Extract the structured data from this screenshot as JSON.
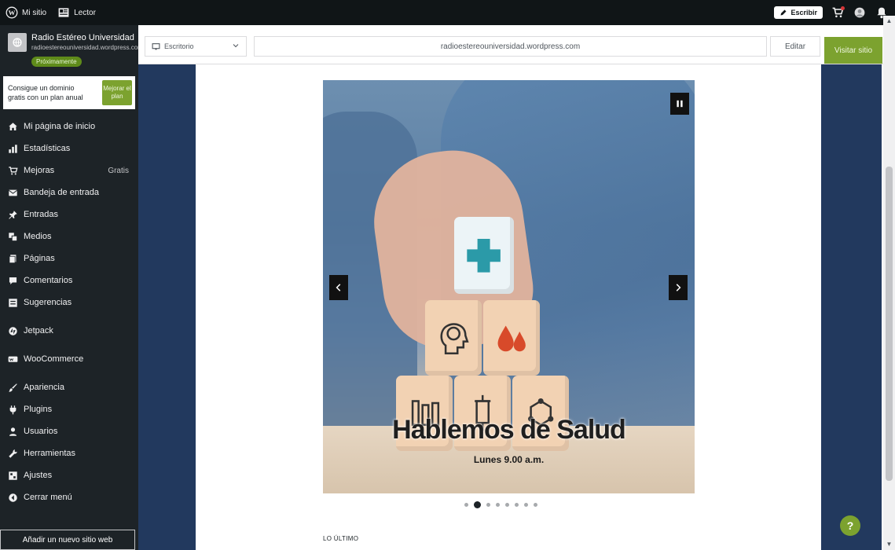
{
  "adminbar": {
    "my_site": "Mi sitio",
    "reader": "Lector",
    "write": "Escribir",
    "icons": [
      "wordpress-icon",
      "reader-icon",
      "pencil-icon",
      "cart-icon",
      "avatar",
      "bell-icon"
    ]
  },
  "sidebar": {
    "site_name": "Radio Estéreo Universidad",
    "site_url": "radioestereouniversidad.wordpress.com",
    "badge": "Próximamente",
    "promo_text": "Consigue un dominio gratis con un plan anual",
    "promo_button": "Mejorar el plan",
    "items": [
      {
        "label": "Mi página de inicio",
        "icon": "home-icon"
      },
      {
        "label": "Estadísticas",
        "icon": "stats-icon"
      },
      {
        "label": "Mejoras",
        "icon": "cart-icon",
        "extra": "Gratis"
      },
      {
        "label": "Bandeja de entrada",
        "icon": "inbox-icon"
      },
      {
        "label": "Entradas",
        "icon": "pin-icon"
      },
      {
        "label": "Medios",
        "icon": "media-icon"
      },
      {
        "label": "Páginas",
        "icon": "pages-icon"
      },
      {
        "label": "Comentarios",
        "icon": "comment-icon"
      },
      {
        "label": "Sugerencias",
        "icon": "feedback-icon"
      },
      {
        "label": "Jetpack",
        "icon": "jetpack-icon"
      },
      {
        "label": "WooCommerce",
        "icon": "woocommerce-icon"
      },
      {
        "label": "Apariencia",
        "icon": "brush-icon"
      },
      {
        "label": "Plugins",
        "icon": "plug-icon"
      },
      {
        "label": "Usuarios",
        "icon": "users-icon"
      },
      {
        "label": "Herramientas",
        "icon": "wrench-icon"
      },
      {
        "label": "Ajustes",
        "icon": "settings-icon"
      },
      {
        "label": "Cerrar menú",
        "icon": "collapse-icon"
      }
    ],
    "add_site": "Añadir un nuevo sitio web"
  },
  "toolbar": {
    "device": "Escritorio",
    "url": "radioestereouniversidad.wordpress.com",
    "edit": "Editar",
    "visit": "Visitar sitio"
  },
  "slide": {
    "title": "Hablemos de Salud",
    "subtitle": "Lunes 9.00 a.m.",
    "total_slides": 8,
    "active_slide": 2
  },
  "section_label": "LO ÚLTIMO",
  "help": "?",
  "colors": {
    "accent_green": "#7ca22f",
    "sidebar_bg": "#1d2327",
    "preview_bg": "#22395e"
  }
}
